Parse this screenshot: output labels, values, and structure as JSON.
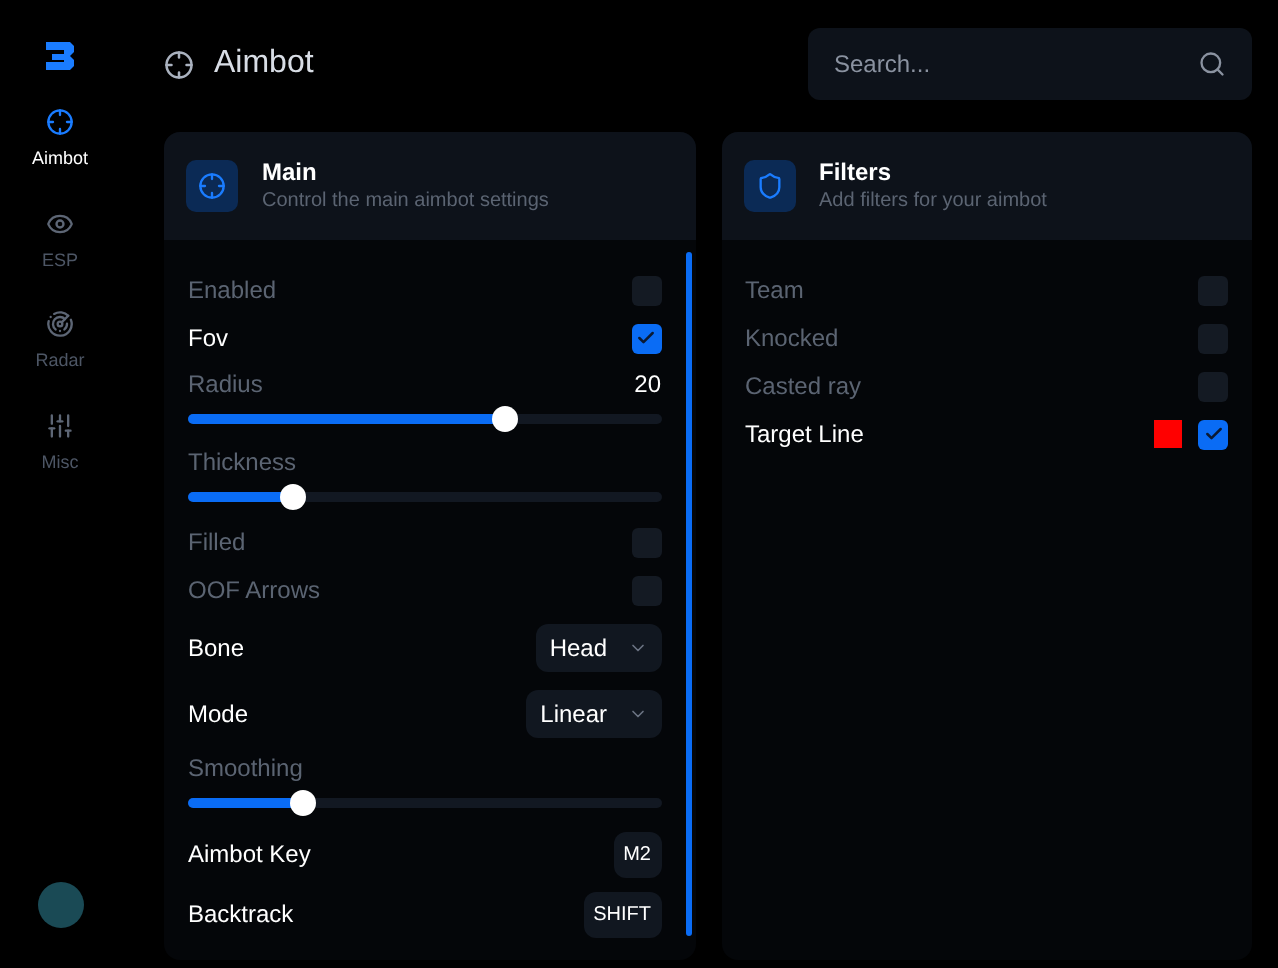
{
  "sidebar": {
    "items": [
      {
        "label": "Aimbot",
        "selected": true
      },
      {
        "label": "ESP",
        "selected": false
      },
      {
        "label": "Radar",
        "selected": false
      },
      {
        "label": "Misc",
        "selected": false
      }
    ]
  },
  "header": {
    "title": "Aimbot",
    "search": {
      "placeholder": "Search..."
    }
  },
  "panels": [
    {
      "title": "Main",
      "subtitle": "Control the main aimbot settings",
      "rows": [
        {
          "kind": "checkbox",
          "label": "Enabled",
          "checked": false
        },
        {
          "kind": "checkbox",
          "label": "Fov",
          "checked": true
        },
        {
          "kind": "slider",
          "label": "Radius",
          "reading": "20",
          "level": 0.67
        },
        {
          "kind": "slider",
          "label": "Thickness",
          "level": 0.22
        },
        {
          "kind": "checkbox",
          "label": "Filled",
          "checked": false
        },
        {
          "kind": "checkbox",
          "label": "OOF Arrows",
          "checked": false
        },
        {
          "kind": "select",
          "label": "Bone",
          "value": "Head"
        },
        {
          "kind": "select",
          "label": "Mode",
          "value": "Linear"
        },
        {
          "kind": "slider",
          "label": "Smoothing",
          "level": 0.24
        },
        {
          "kind": "key",
          "label": "Aimbot Key",
          "value": "M2"
        },
        {
          "kind": "key",
          "label": "Backtrack",
          "value": "SHIFT"
        }
      ]
    },
    {
      "title": "Filters",
      "subtitle": "Add filters for your aimbot",
      "rows": [
        {
          "kind": "checkbox",
          "label": "Team",
          "checked": false
        },
        {
          "kind": "checkbox",
          "label": "Knocked",
          "checked": false
        },
        {
          "kind": "checkbox",
          "label": "Casted ray",
          "checked": false
        },
        {
          "kind": "checkbox",
          "label": "Target Line",
          "checked": true,
          "color": "#ff0000"
        }
      ]
    }
  ]
}
